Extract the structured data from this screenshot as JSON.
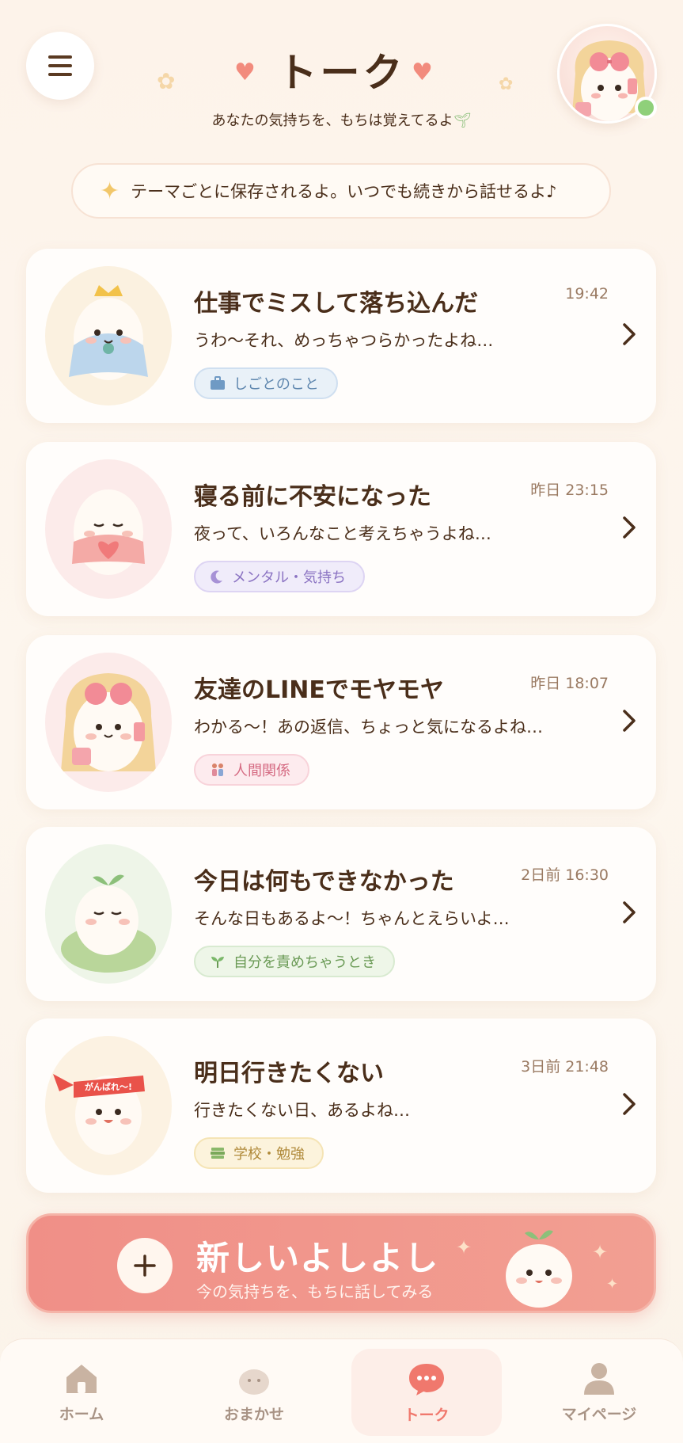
{
  "header": {
    "title": "トーク",
    "subtitle": "あなたの気持ちを、もちは覚えてるよ"
  },
  "notice": {
    "text": "テーマごとに保存されるよ。いつでも続きから話せるよ♪"
  },
  "conversations": [
    {
      "title": "仕事でミスして落ち込んだ",
      "time": "19:42",
      "preview": "うわ〜それ、めっちゃつらかったよね…",
      "tag": "しごとのこと",
      "tag_icon": "briefcase-icon"
    },
    {
      "title": "寝る前に不安になった",
      "time": "昨日 23:15",
      "preview": "夜って、いろんなこと考えちゃうよね…",
      "tag": "メンタル・気持ち",
      "tag_icon": "moon-icon"
    },
    {
      "title": "友達のLINEでモヤモヤ",
      "time": "昨日 18:07",
      "preview": "わかる〜！あの返信、ちょっと気になるよね…",
      "tag": "人間関係",
      "tag_icon": "people-icon"
    },
    {
      "title": "今日は何もできなかった",
      "time": "2日前 16:30",
      "preview": "そんな日もあるよ〜！ちゃんとえらいよ…",
      "tag": "自分を責めちゃうとき",
      "tag_icon": "sprout-icon"
    },
    {
      "title": "明日行きたくない",
      "time": "3日前 21:48",
      "preview": "行きたくない日、あるよね…",
      "tag": "学校・勉強",
      "tag_icon": "books-icon"
    }
  ],
  "new_chat": {
    "title": "新しいよしよし",
    "subtitle": "今の気持ちを、もちに話してみる"
  },
  "mascot_headband_text": "がんばれ〜!",
  "tabs": [
    {
      "label": "ホーム",
      "icon": "home-icon"
    },
    {
      "label": "おまかせ",
      "icon": "mochi-icon"
    },
    {
      "label": "トーク",
      "icon": "chat-bubble-icon",
      "active": true
    },
    {
      "label": "マイページ",
      "icon": "person-icon"
    }
  ],
  "colors": {
    "accent": "#f0786d",
    "text": "#4a2e1a",
    "background": "#fdf3ea",
    "online": "#8fd07a"
  }
}
